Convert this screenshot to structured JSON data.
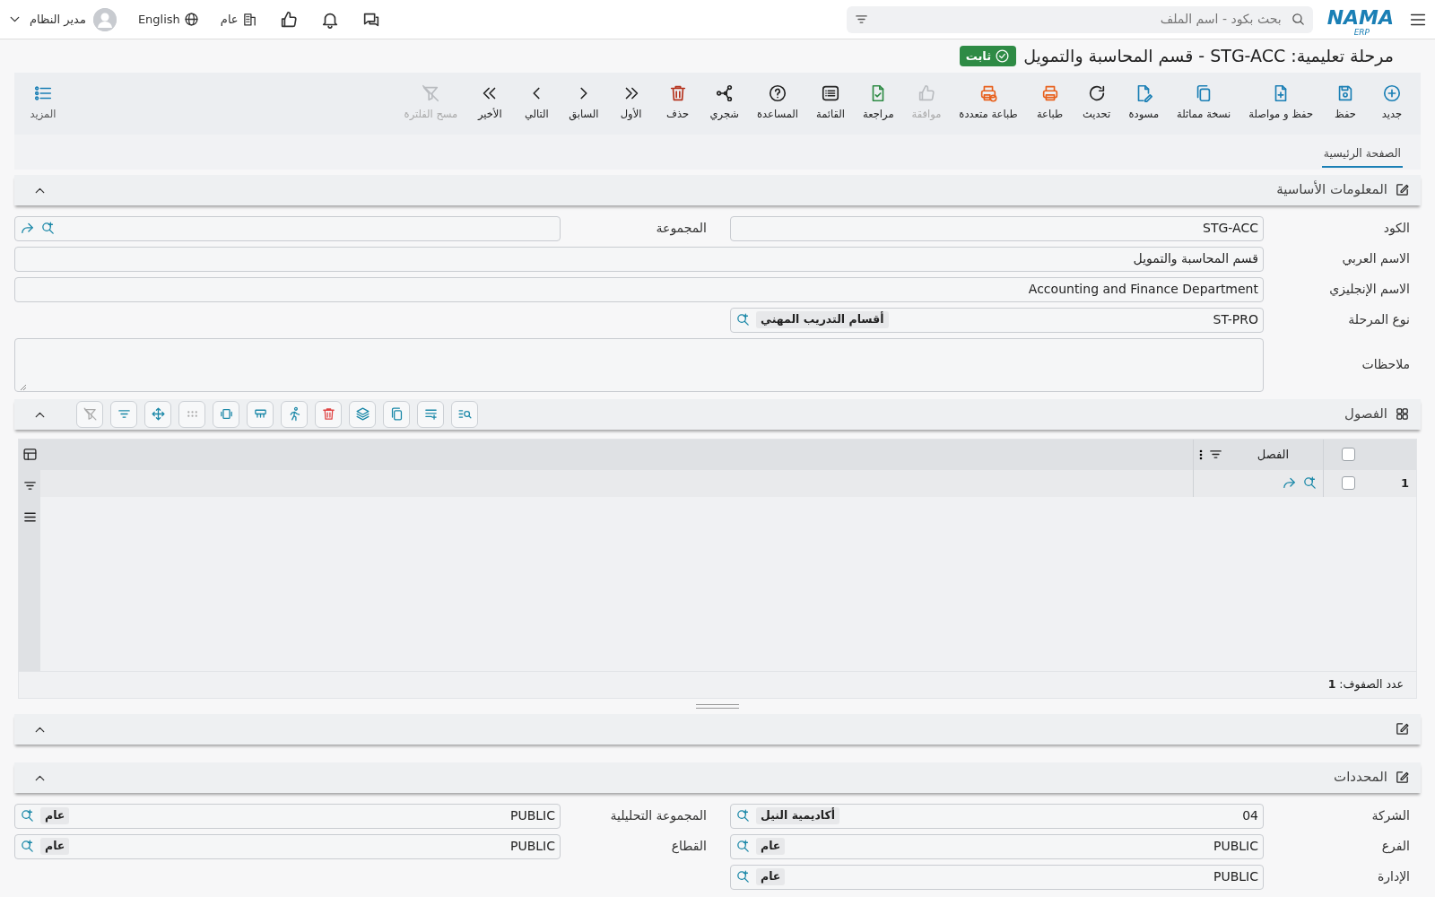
{
  "topbar": {
    "logo": "NAMA",
    "logo_sub": "ERP",
    "search": {
      "placeholder": "بحث بكود - اسم الملف"
    },
    "company": "عام",
    "language": "English",
    "user": "مدير النظام"
  },
  "title": "مرحلة تعليمية: STG-ACC - قسم المحاسبة والتمويل",
  "status_badge": "ثابت",
  "toolbar": [
    {
      "label": "جديد",
      "disabled": false
    },
    {
      "label": "حفظ",
      "disabled": false
    },
    {
      "label": "حفظ و مواصلة",
      "disabled": false
    },
    {
      "label": "نسخة مماثلة",
      "disabled": false
    },
    {
      "label": "مسودة",
      "disabled": false
    },
    {
      "label": "تحديث",
      "disabled": false
    },
    {
      "label": "طباعة",
      "disabled": false
    },
    {
      "label": "طباعة متعددة",
      "disabled": false
    },
    {
      "label": "موافقة",
      "disabled": true
    },
    {
      "label": "مراجعة",
      "disabled": false
    },
    {
      "label": "القائمة",
      "disabled": false
    },
    {
      "label": "المساعدة",
      "disabled": false
    },
    {
      "label": "شجري",
      "disabled": false
    },
    {
      "label": "حذف",
      "disabled": false
    },
    {
      "label": "الأول",
      "disabled": false
    },
    {
      "label": "السابق",
      "disabled": false
    },
    {
      "label": "التالي",
      "disabled": false
    },
    {
      "label": "الأخير",
      "disabled": false
    },
    {
      "label": "مسح الفلترة",
      "disabled": true
    }
  ],
  "more_button": "المزيد",
  "tabs": [
    {
      "label": "الصفحة الرئيسية",
      "selected": true
    }
  ],
  "basic_info": {
    "title": "المعلومات الأساسية",
    "expanded": true,
    "rows": [
      {
        "kind": "pair",
        "fields": [
          {
            "label": "الكود",
            "kind": "text",
            "value": "STG-ACC"
          },
          {
            "label": "المجموعة",
            "kind": "lookup"
          }
        ]
      },
      {
        "kind": "full",
        "fields": [
          {
            "label": "الاسم العربي",
            "kind": "text",
            "value": "قسم المحاسبة والتمويل"
          }
        ]
      },
      {
        "kind": "full",
        "fields": [
          {
            "label": "الاسم الإنجليزي",
            "kind": "text",
            "value": "Accounting and Finance Department"
          }
        ]
      },
      {
        "kind": "half",
        "fields": [
          {
            "label": "نوع المرحلة",
            "kind": "ref",
            "value": "ST-PRO",
            "tag": "أقسام التدريب المهني"
          }
        ]
      },
      {
        "kind": "full",
        "fields": [
          {
            "label": "ملاحظات",
            "kind": "textarea"
          }
        ]
      }
    ]
  },
  "classes": {
    "title": "الفصول",
    "expanded": true,
    "columns": [
      {
        "label": "الفصل"
      }
    ],
    "header_checked": false,
    "rows": [
      {
        "number": "1",
        "checked": false
      }
    ],
    "footer": "عدد الصفوف: **1**"
  },
  "blank_section": {
    "expanded": true
  },
  "dimensions": {
    "title": "المحددات",
    "expanded": true,
    "rows": [
      {
        "kind": "pair",
        "fields": [
          {
            "label": "الشركة",
            "kind": "ref",
            "value": "04",
            "tag": "أكاديمية النيل"
          },
          {
            "label": "المجموعة التحليلية",
            "kind": "ref",
            "value": "PUBLIC",
            "tag": "عام"
          }
        ]
      },
      {
        "kind": "pair",
        "fields": [
          {
            "label": "الفرع",
            "kind": "ref",
            "value": "PUBLIC",
            "tag": "عام"
          },
          {
            "label": "القطاع",
            "kind": "ref",
            "value": "PUBLIC",
            "tag": "عام"
          }
        ]
      },
      {
        "kind": "half",
        "fields": [
          {
            "label": "الإدارة",
            "kind": "ref",
            "value": "PUBLIC",
            "tag": "عام"
          }
        ]
      }
    ]
  }
}
